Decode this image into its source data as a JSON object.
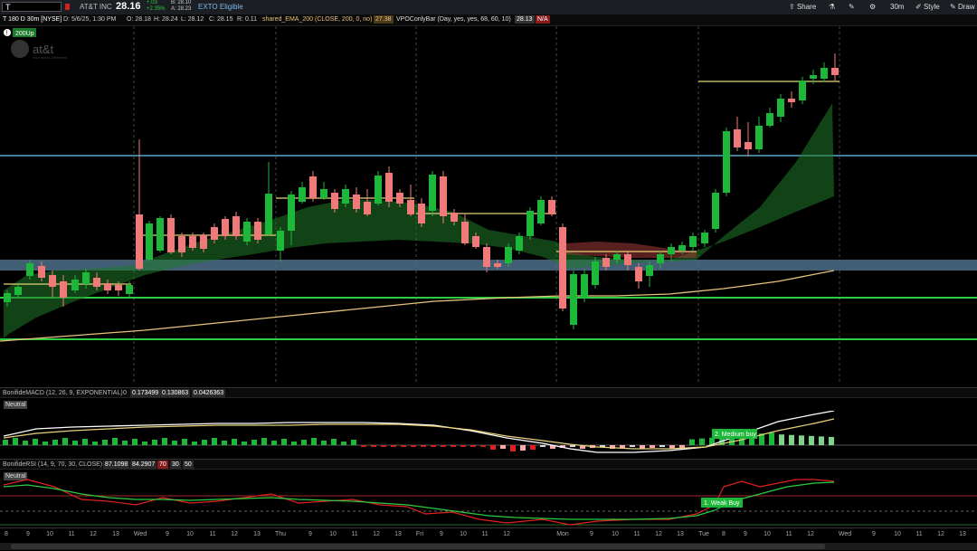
{
  "toolbar": {
    "symbol": "T",
    "company": "AT&T INC",
    "last": "28.16",
    "chg_top": "+.03",
    "chg_pct": "+2.35%",
    "bid": "B: 28.10",
    "ask": "A: 28.23",
    "exto": "EXTO Eligible",
    "share": "Share",
    "timeframe": "30m",
    "style": "Style",
    "drawings": "Draw"
  },
  "infobar": {
    "desc": "T 180 D 30m [NYSE]",
    "date": "D: 5/6/25, 1:30 PM",
    "open": "O: 28.18",
    "high": "H: 28.24",
    "low": "L: 28.12",
    "close": "C: 28.15",
    "range": "R: 0.11",
    "ema": "shared_EMA_200 (CLOSE, 200, 0, no)",
    "ema_val": "27.38",
    "vpoc": "VPOConlyBar (Day, yes, yes, 68, 60, 10)",
    "vpoc_val": "28.13",
    "na": "N/A"
  },
  "overlay": {
    "badge": "200Up",
    "logo": "at&t",
    "logo_sub": "Your world. Delivered."
  },
  "macd": {
    "title": "BonifideMACD (12, 26, 9, EXPONENTIAL)",
    "v0": "0",
    "v1": "0.173499",
    "v2": "0.130863",
    "v3": "0.0426363",
    "neutral": "Neutral",
    "signal": "2. Medium buy"
  },
  "rsi": {
    "title": "BonifideRSI (14, 9, 70, 30, CLOSE)",
    "v1": "87.1098",
    "v2": "84.2907",
    "v3": "70",
    "v4": "30",
    "v5": "50",
    "neutral": "Neutral",
    "signal": "1. Weak Buy"
  },
  "xaxis": [
    {
      "label": "8"
    },
    {
      "label": "9"
    },
    {
      "label": "10"
    },
    {
      "label": "11"
    },
    {
      "label": "12"
    },
    {
      "label": "13"
    },
    {
      "label": "Wed"
    },
    {
      "label": "9"
    },
    {
      "label": "10"
    },
    {
      "label": "11"
    },
    {
      "label": "12"
    },
    {
      "label": "13"
    },
    {
      "label": "Thu"
    },
    {
      "label": "9"
    },
    {
      "label": "10"
    },
    {
      "label": "11"
    },
    {
      "label": "12"
    },
    {
      "label": "13"
    },
    {
      "label": "Fri"
    },
    {
      "label": "9"
    },
    {
      "label": "10"
    },
    {
      "label": "11"
    },
    {
      "label": "12"
    },
    {
      "label": "Mon"
    },
    {
      "label": "9"
    },
    {
      "label": "10"
    },
    {
      "label": "11"
    },
    {
      "label": "12"
    },
    {
      "label": "13"
    },
    {
      "label": "Tue"
    },
    {
      "label": "8"
    },
    {
      "label": "9"
    },
    {
      "label": "10"
    },
    {
      "label": "11"
    },
    {
      "label": "12"
    },
    {
      "label": "Wed"
    },
    {
      "label": "9"
    },
    {
      "label": "10"
    },
    {
      "label": "11"
    },
    {
      "label": "12"
    },
    {
      "label": "13"
    }
  ],
  "colors": {
    "up": "#1db83a",
    "down": "#f07a7a",
    "ema": "#e8c27a",
    "support": "#2ecc40",
    "resistance": "#5aa7c8",
    "zone": "#4e6f8a"
  }
}
